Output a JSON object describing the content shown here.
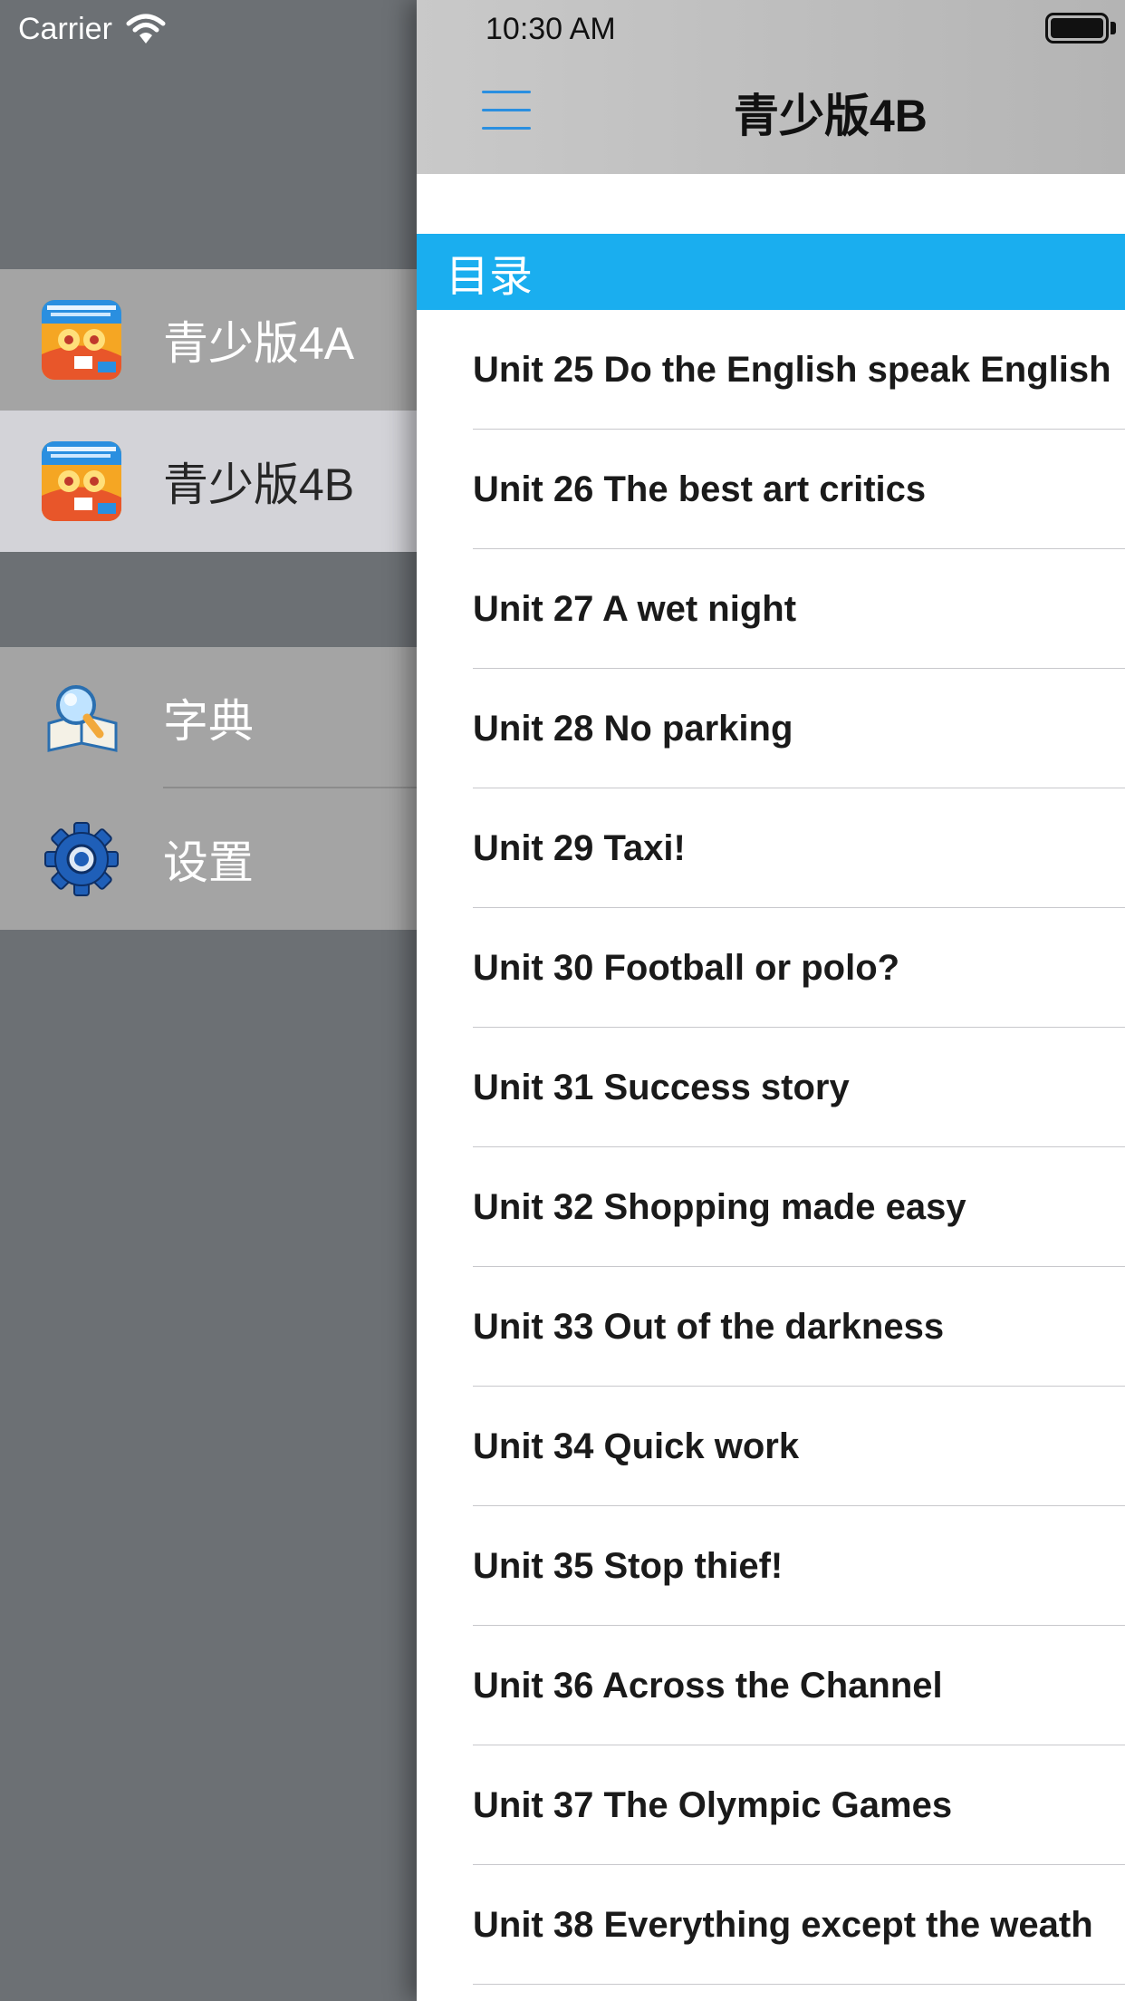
{
  "drawer": {
    "carrier": "Carrier",
    "books": [
      {
        "label": "青少版4A",
        "selected": false
      },
      {
        "label": "青少版4B",
        "selected": true
      }
    ],
    "tools": [
      {
        "label": "字典",
        "icon": "dictionary-icon"
      },
      {
        "label": "设置",
        "icon": "gear-icon"
      }
    ]
  },
  "main": {
    "time": "10:30 AM",
    "title": "青少版4B",
    "menu_icon": "hamburger-menu-icon",
    "section": "目录",
    "units": [
      "Unit 25 Do the English speak English",
      "Unit 26 The best art critics",
      "Unit 27 A wet night",
      "Unit 28 No parking",
      "Unit 29 Taxi!",
      "Unit 30 Football or polo?",
      "Unit 31 Success story",
      "Unit 32 Shopping made easy",
      "Unit 33 Out of the darkness",
      "Unit 34 Quick work",
      "Unit 35 Stop thief!",
      "Unit 36 Across the Channel",
      "Unit 37 The Olympic Games",
      "Unit 38 Everything except the weath"
    ]
  },
  "colors": {
    "drawer_bg": "#6c7074",
    "selected_row": "#d3d3d8",
    "row": "#a4a4a4",
    "section_header": "#1aaeef",
    "menu_icon": "#2a8fe0"
  }
}
